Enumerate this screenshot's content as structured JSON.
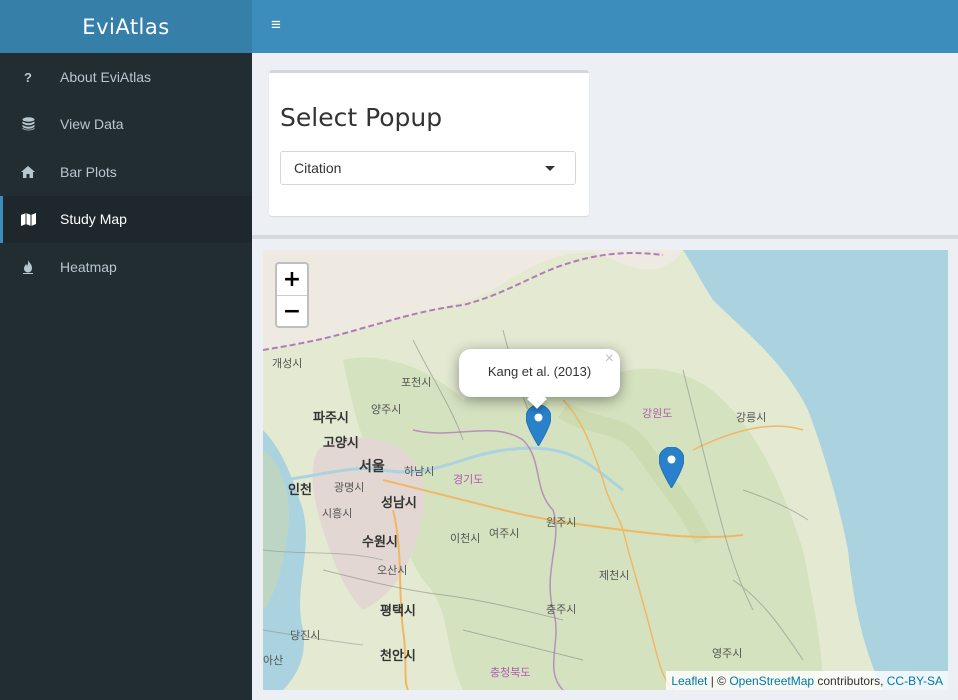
{
  "header": {
    "logo": "EviAtlas",
    "toggle_icon": "≡"
  },
  "sidebar": {
    "items": [
      {
        "label": "About EviAtlas",
        "icon": "question-icon",
        "active": false
      },
      {
        "label": "View Data",
        "icon": "database-icon",
        "active": false
      },
      {
        "label": "Bar Plots",
        "icon": "home-icon",
        "active": false
      },
      {
        "label": "Study Map",
        "icon": "map-icon",
        "active": true
      },
      {
        "label": "Heatmap",
        "icon": "fire-icon",
        "active": false
      }
    ]
  },
  "popup_box": {
    "title": "Select Popup",
    "selected": "Citation"
  },
  "map": {
    "zoom_in": "+",
    "zoom_out": "−",
    "popup": {
      "text": "Kang et al. (2013)",
      "close": "×"
    },
    "markers": [
      {
        "name": "marker-1"
      },
      {
        "name": "marker-2"
      }
    ],
    "marker_color": "#2a81cb",
    "labels": {
      "gaeseong": "개성시",
      "pocheon": "포천시",
      "paju": "파주시",
      "yangju": "양주시",
      "goyang": "고양시",
      "seoul": "서울",
      "hanam": "하남시",
      "incheon": "인천",
      "gwangmyeong": "광명시",
      "gyeonggi": "경기도",
      "siheung": "시흥시",
      "seongnam": "성남시",
      "yeoju": "여주시",
      "wonju": "원주시",
      "suwon": "수원시",
      "icheon": "이천시",
      "osan": "오산시",
      "jecheon": "제천시",
      "pyeongtaek": "평택시",
      "chungju": "충주시",
      "dangjin": "당진시",
      "cheonan": "천안시",
      "yeongju": "영주시",
      "chungbuk": "충청북도",
      "gangwon": "강원도",
      "gangneung": "강릉시",
      "asan": "아산"
    },
    "attribution": {
      "leaflet": "Leaflet",
      "sep": " | © ",
      "osm": "OpenStreetMap",
      "contrib": " contributors, ",
      "license": "CC-BY-SA"
    }
  }
}
